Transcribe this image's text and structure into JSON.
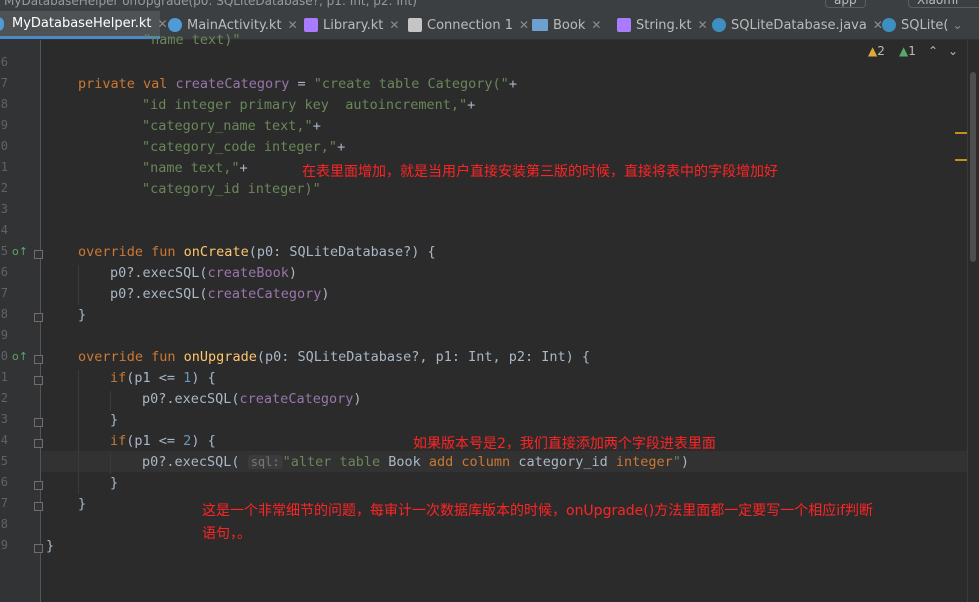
{
  "breadcrumb": "MyDatabaseHelper  onUpgrade(p0: SQLiteDatabase?, p1: Int, p2: Int)",
  "run_config": "app",
  "device_label": "Xiaomi",
  "tabs": [
    {
      "label": "MyDatabaseHelper.kt",
      "icon": "kotlin-class-icon",
      "color": "#4f9bd6",
      "active": true
    },
    {
      "label": "MainActivity.kt",
      "icon": "kotlin-class-icon",
      "color": "#4f9bd6",
      "active": false
    },
    {
      "label": "Library.kt",
      "icon": "kotlin-file-icon",
      "color": "#a97bff",
      "active": false
    },
    {
      "label": "Connection 1",
      "icon": "database-console-icon",
      "color": "#c5c5c5",
      "active": false
    },
    {
      "label": "Book",
      "icon": "table-icon",
      "color": "#6d9fd0",
      "active": false
    },
    {
      "label": "String.kt",
      "icon": "kotlin-file-icon",
      "color": "#a97bff",
      "active": false
    },
    {
      "label": "SQLiteDatabase.java",
      "icon": "java-class-icon",
      "color": "#3d8fbf",
      "active": false
    },
    {
      "label": "SQLite(",
      "icon": "java-class-icon",
      "color": "#3d8fbf",
      "active": false
    }
  ],
  "inspections": {
    "warnings": "2",
    "weak_warnings": "1"
  },
  "line_number_fragments": [
    "6",
    "7",
    "8",
    "9",
    "0",
    "1",
    "2",
    "3",
    "4",
    "5",
    "6",
    "7",
    "8",
    "9",
    "0",
    "1",
    "2",
    "3",
    "4",
    "5",
    "6",
    "7",
    "8",
    "9"
  ],
  "code": {
    "l0": "        \"name text)\"",
    "l2_kw": "private val ",
    "l2_name": "createCategory",
    "l2_rest": " = ",
    "l2_str": "\"create table Category(\"",
    "l2_plus": "+",
    "l3": "\"id integer primary key  autoincrement,\"",
    "l4": "\"category_name text,\"",
    "l5": "\"category_code integer,\"",
    "l6": "\"name text,\"",
    "l7": "\"category_id integer)\"",
    "plus": "+",
    "l10_kw": "override fun ",
    "l10_fn": "onCreate",
    "l10_rest": "(p0: SQLiteDatabase?) {",
    "l11_a": "p0?.execSQL(",
    "l11_b": "createBook",
    "l11_c": ")",
    "l12_a": "p0?.execSQL(",
    "l12_b": "createCategory",
    "l12_c": ")",
    "close": "}",
    "l15_kw": "override fun ",
    "l15_fn": "onUpgrade",
    "l15_rest": "(p0: SQLiteDatabase?, p1: Int, p2: Int) {",
    "l16_kw": "if",
    "l16_rest": "(p1 <= ",
    "l16_num": "1",
    "l16_end": ") {",
    "l17_a": "p0?.execSQL(",
    "l17_b": "createCategory",
    "l17_c": ")",
    "l19_kw": "if",
    "l19_rest": "(p1 <= ",
    "l19_num": "2",
    "l19_end": ") {",
    "l20_a": "p0?.execSQL(",
    "l20_hint": "sql:",
    "l20_str1": "\"alter table ",
    "l20_id1": "Book",
    "l20_kw1": " add column ",
    "l20_id2": "category_id",
    "l20_kw2": " integer",
    "l20_str2": "\"",
    "l20_c": ")"
  },
  "annotations": {
    "a1": "在表里面增加，就是当用户直接安装第三版的时候，直接将表中的字段增加好",
    "a2": "如果版本号是2，我们直接添加两个字段进表里面",
    "a3_line1": "这是一个非常细节的问题，每审计一次数据库版本的时候，onUpgrade()方法里面都一定要写一个相应if判断",
    "a3_line2": "语句，。"
  }
}
